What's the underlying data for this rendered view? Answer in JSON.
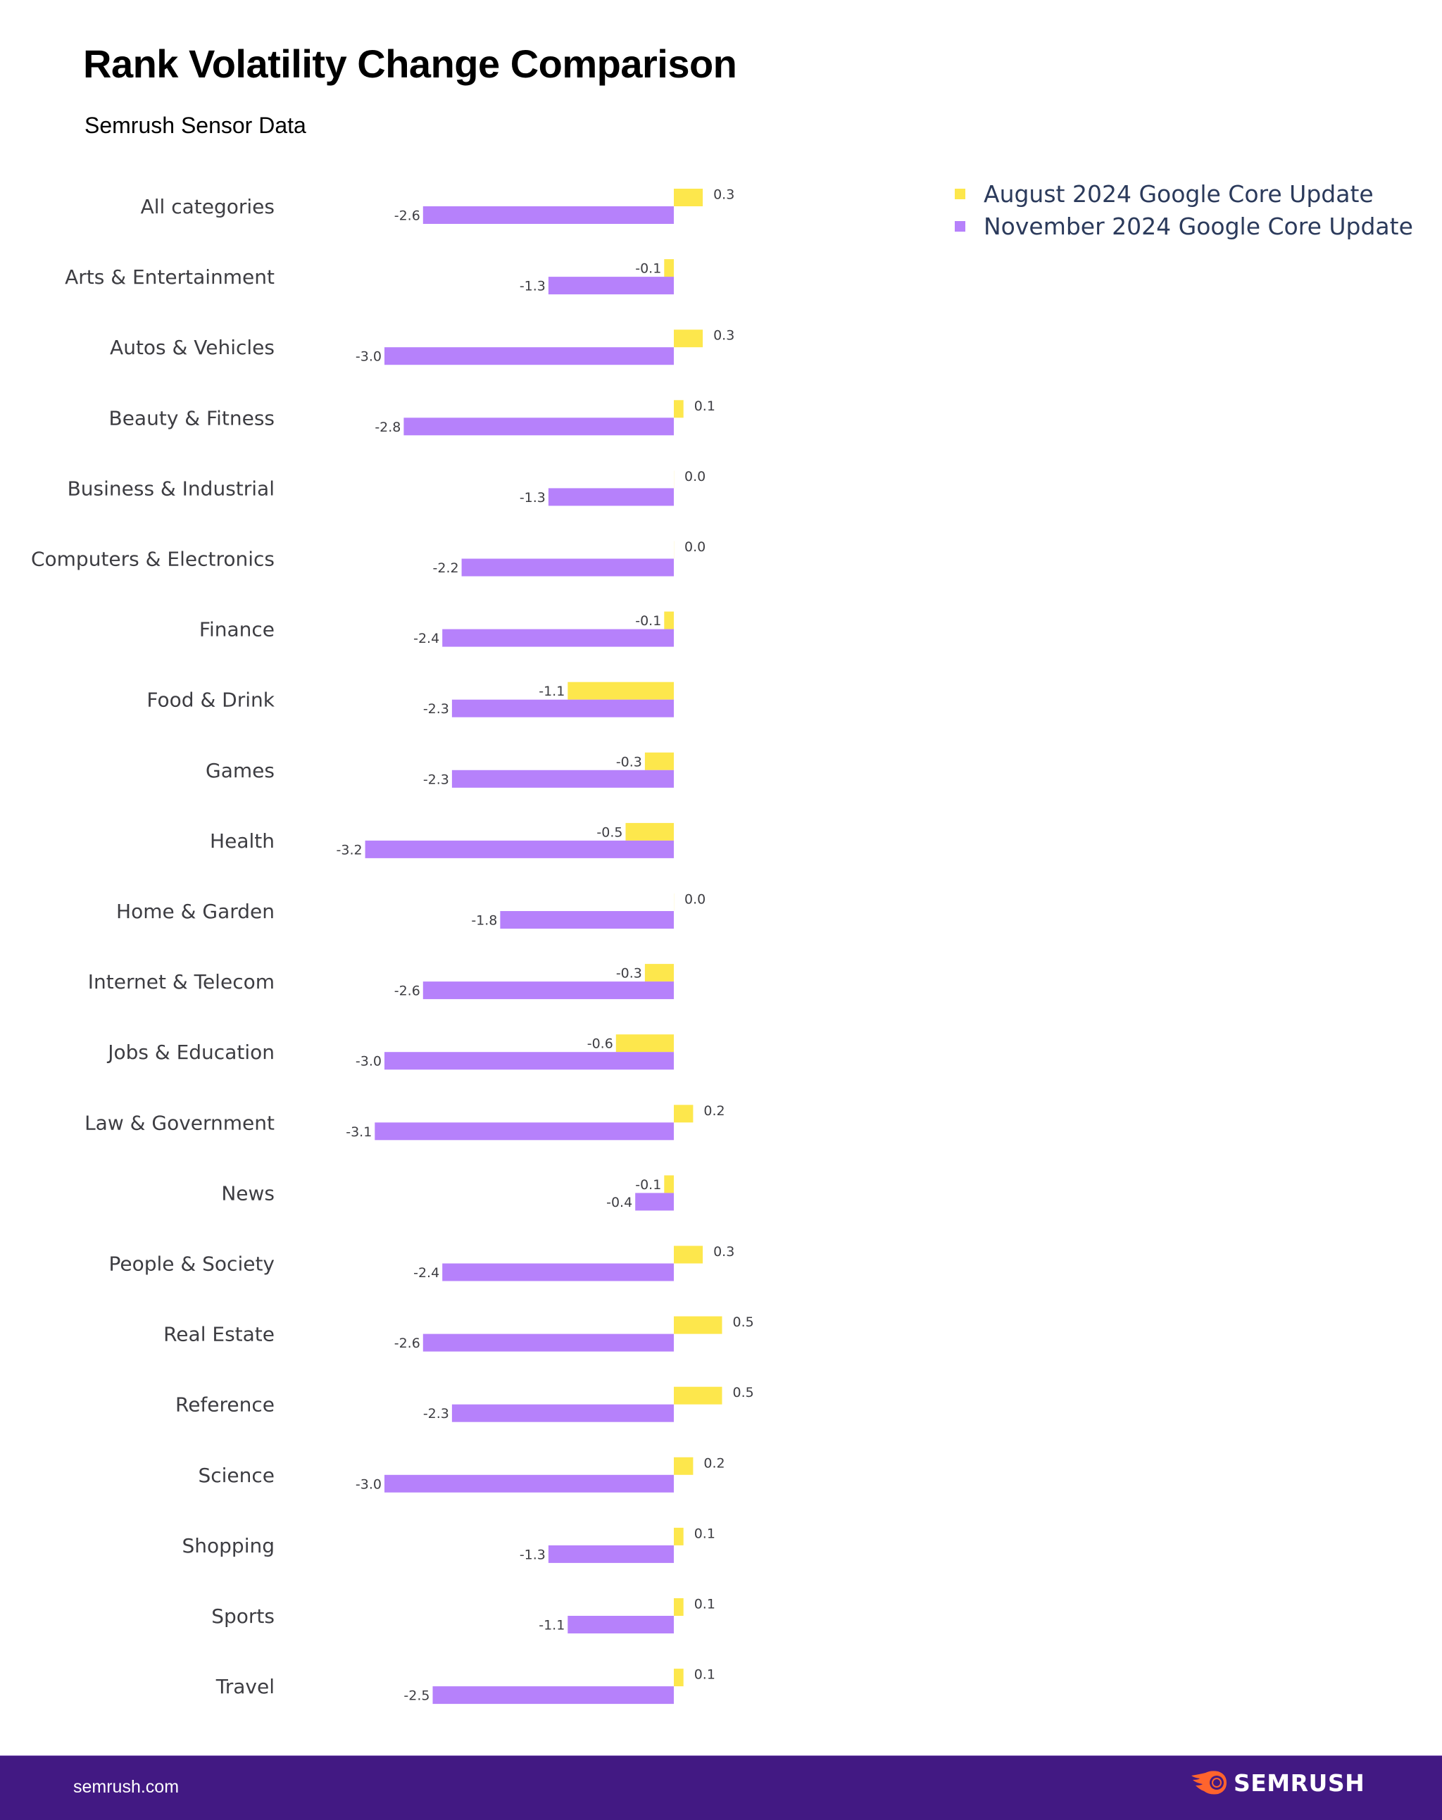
{
  "header": {
    "title": "Rank Volatility Change Comparison",
    "subtitle": "Semrush Sensor Data"
  },
  "legend": [
    {
      "label": "August 2024 Google Core Update",
      "color": "#fde74c"
    },
    {
      "label": "November 2024 Google Core Update",
      "color": "#b681fb"
    }
  ],
  "footer": {
    "url": "semrush.com",
    "logo_text": "SEMRUSH",
    "logo_icon": "semrush-fireball-icon"
  },
  "chart_data": {
    "type": "bar",
    "orientation": "horizontal",
    "title": "Rank Volatility Change Comparison",
    "subtitle": "Semrush Sensor Data",
    "xlabel": "",
    "ylabel": "",
    "grid": false,
    "legend_position": "top-right",
    "xlim": [
      -3.2,
      0.5
    ],
    "categories": [
      "All categories",
      "Arts & Entertainment",
      "Autos & Vehicles",
      "Beauty & Fitness",
      "Business & Industrial",
      "Computers & Electronics",
      "Finance",
      "Food & Drink",
      "Games",
      "Health",
      "Home & Garden",
      "Internet & Telecom",
      "Jobs & Education",
      "Law & Government",
      "News",
      "People & Society",
      "Real Estate",
      "Reference",
      "Science",
      "Shopping",
      "Sports",
      "Travel"
    ],
    "series": [
      {
        "name": "August 2024 Google Core Update",
        "color": "#fde74c",
        "values": [
          0.3,
          -0.1,
          0.3,
          0.1,
          0.0,
          0.0,
          -0.1,
          -1.1,
          -0.3,
          -0.5,
          0.0,
          -0.3,
          -0.6,
          0.2,
          -0.1,
          0.3,
          0.5,
          0.5,
          0.2,
          0.1,
          0.1,
          0.1
        ]
      },
      {
        "name": "November 2024 Google Core Update",
        "color": "#b681fb",
        "values": [
          -2.6,
          -1.3,
          -3.0,
          -2.8,
          -1.3,
          -2.2,
          -2.4,
          -2.3,
          -2.3,
          -3.2,
          -1.8,
          -2.6,
          -3.0,
          -3.1,
          -0.4,
          -2.4,
          -2.6,
          -2.3,
          -3.0,
          -1.3,
          -1.1,
          -2.5
        ]
      }
    ]
  }
}
